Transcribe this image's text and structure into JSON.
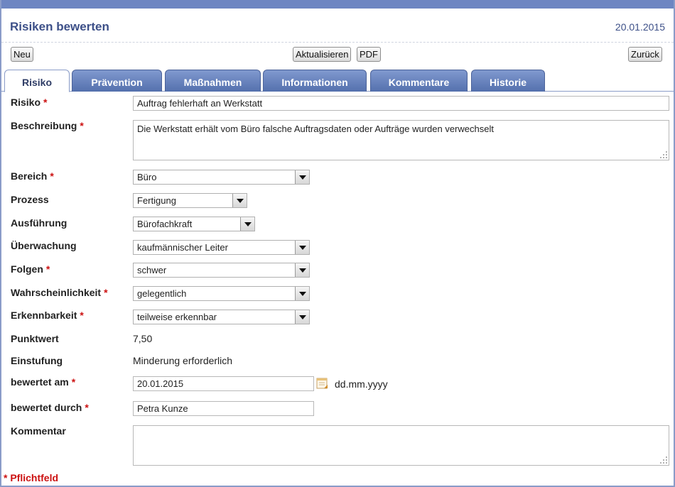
{
  "header": {
    "title": "Risiken bewerten",
    "date": "20.01.2015"
  },
  "toolbar": {
    "new_label": "Neu",
    "refresh_label": "Aktualisieren",
    "pdf_label": "PDF",
    "back_label": "Zurück"
  },
  "tabs": [
    {
      "label": "Risiko"
    },
    {
      "label": "Prävention"
    },
    {
      "label": "Maßnahmen"
    },
    {
      "label": "Informationen"
    },
    {
      "label": "Kommentare"
    },
    {
      "label": "Historie"
    }
  ],
  "form": {
    "risiko": {
      "label": "Risiko",
      "required": "*",
      "value": "Auftrag fehlerhaft an Werkstatt"
    },
    "beschreibung": {
      "label": "Beschreibung",
      "required": "*",
      "value": "Die Werkstatt erhält vom Büro falsche Auftragsdaten oder Aufträge wurden verwechselt"
    },
    "bereich": {
      "label": "Bereich",
      "required": "*",
      "value": "Büro"
    },
    "prozess": {
      "label": "Prozess",
      "value": "Fertigung"
    },
    "ausfuehrung": {
      "label": "Ausführung",
      "value": "Bürofachkraft"
    },
    "ueberwachung": {
      "label": "Überwachung",
      "value": "kaufmännischer Leiter"
    },
    "folgen": {
      "label": "Folgen",
      "required": "*",
      "value": "schwer"
    },
    "wahrscheinlichkeit": {
      "label": "Wahrscheinlichkeit",
      "required": "*",
      "value": "gelegentlich"
    },
    "erkennbarkeit": {
      "label": "Erkennbarkeit",
      "required": "*",
      "value": "teilweise erkennbar"
    },
    "punktwert": {
      "label": "Punktwert",
      "value": "7,50"
    },
    "einstufung": {
      "label": "Einstufung",
      "value": "Minderung erforderlich"
    },
    "bewertet_am": {
      "label": "bewertet am",
      "required": "*",
      "value": "20.01.2015",
      "hint": "dd.mm.yyyy"
    },
    "bewertet_durch": {
      "label": "bewertet durch",
      "required": "*",
      "value": "Petra Kunze"
    },
    "kommentar": {
      "label": "Kommentar",
      "value": ""
    }
  },
  "footer": {
    "required_note": "* Pflichtfeld"
  },
  "colors": {
    "accent": "#6e86c2",
    "tab": "#5f7ab8",
    "title": "#3d5088",
    "required": "#cc1111"
  },
  "icons": {
    "calendar": "calendar-icon",
    "resize": "resize-grip-icon",
    "dropdown": "chevron-down-icon"
  }
}
